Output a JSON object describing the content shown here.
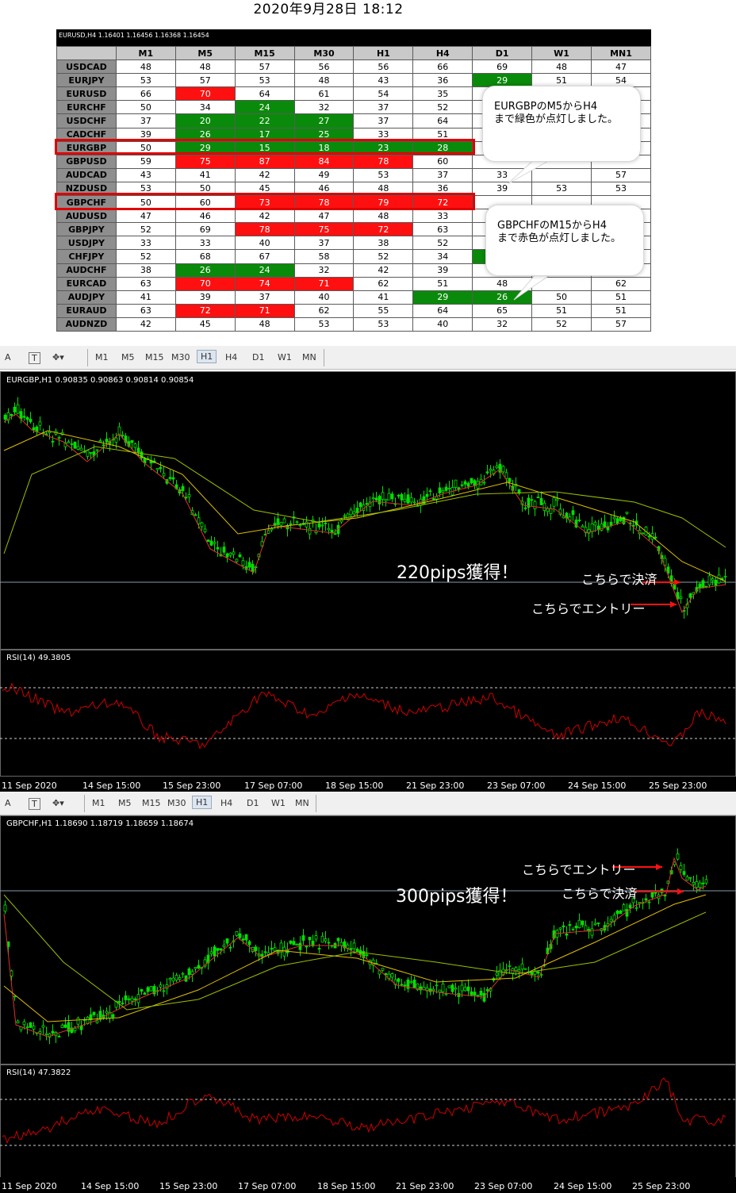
{
  "header": {
    "date": "2020年9月28日 18:12"
  },
  "table": {
    "title": "EURUSD,H4  1.16401 1.16456 1.16368 1.16454",
    "columns": [
      "M1",
      "M5",
      "M15",
      "M30",
      "H1",
      "H4",
      "D1",
      "W1",
      "MN1"
    ],
    "rows": [
      {
        "sym": "USDCAD",
        "vals": [
          "48",
          "48",
          "57",
          "56",
          "56",
          "66",
          "69",
          "48",
          "47"
        ],
        "c": [
          "",
          "",
          "",
          "",
          "",
          "",
          "",
          "",
          ""
        ]
      },
      {
        "sym": "EURJPY",
        "vals": [
          "53",
          "57",
          "53",
          "48",
          "43",
          "36",
          "29",
          "51",
          "54"
        ],
        "c": [
          "",
          "",
          "",
          "",
          "",
          "",
          "g",
          "",
          ""
        ]
      },
      {
        "sym": "EURUSD",
        "vals": [
          "66",
          "70",
          "64",
          "61",
          "54",
          "35",
          "",
          "",
          ""
        ],
        "c": [
          "",
          "r",
          "",
          "",
          "",
          "",
          "",
          "",
          ""
        ]
      },
      {
        "sym": "EURCHF",
        "vals": [
          "50",
          "34",
          "24",
          "32",
          "37",
          "52",
          "",
          "",
          ""
        ],
        "c": [
          "",
          "",
          "g",
          "",
          "",
          "",
          "",
          "",
          ""
        ]
      },
      {
        "sym": "USDCHF",
        "vals": [
          "37",
          "20",
          "22",
          "27",
          "37",
          "64",
          "",
          "",
          ""
        ],
        "c": [
          "",
          "g",
          "g",
          "g",
          "",
          "",
          "",
          "",
          ""
        ]
      },
      {
        "sym": "CADCHF",
        "vals": [
          "39",
          "26",
          "17",
          "25",
          "33",
          "51",
          "",
          "",
          ""
        ],
        "c": [
          "",
          "g",
          "g",
          "g",
          "",
          "",
          "",
          "",
          ""
        ]
      },
      {
        "sym": "EURGBP",
        "vals": [
          "50",
          "29",
          "15",
          "18",
          "23",
          "28",
          "",
          "",
          ""
        ],
        "c": [
          "",
          "g",
          "g",
          "g",
          "g",
          "g",
          "",
          "",
          ""
        ]
      },
      {
        "sym": "GBPUSD",
        "vals": [
          "59",
          "75",
          "87",
          "84",
          "78",
          "60",
          "",
          "",
          ""
        ],
        "c": [
          "",
          "r",
          "r",
          "r",
          "r",
          "",
          "",
          "",
          ""
        ]
      },
      {
        "sym": "AUDCAD",
        "vals": [
          "43",
          "41",
          "42",
          "49",
          "53",
          "37",
          "33",
          "",
          "57"
        ],
        "c": [
          "",
          "",
          "",
          "",
          "",
          "",
          "",
          "",
          ""
        ]
      },
      {
        "sym": "NZDUSD",
        "vals": [
          "53",
          "50",
          "45",
          "46",
          "48",
          "36",
          "39",
          "53",
          "53"
        ],
        "c": [
          "",
          "",
          "",
          "",
          "",
          "",
          "",
          "",
          ""
        ]
      },
      {
        "sym": "GBPCHF",
        "vals": [
          "50",
          "60",
          "73",
          "78",
          "79",
          "72",
          "",
          "",
          ""
        ],
        "c": [
          "",
          "",
          "r",
          "r",
          "r",
          "r",
          "",
          "",
          ""
        ]
      },
      {
        "sym": "AUDUSD",
        "vals": [
          "47",
          "46",
          "42",
          "47",
          "48",
          "33",
          "",
          "",
          ""
        ],
        "c": [
          "",
          "",
          "",
          "",
          "",
          "",
          "",
          "",
          ""
        ]
      },
      {
        "sym": "GBPJPY",
        "vals": [
          "52",
          "69",
          "78",
          "75",
          "72",
          "63",
          "",
          "",
          ""
        ],
        "c": [
          "",
          "",
          "r",
          "r",
          "r",
          "",
          "",
          "",
          ""
        ]
      },
      {
        "sym": "USDJPY",
        "vals": [
          "33",
          "33",
          "40",
          "37",
          "38",
          "52",
          "",
          "",
          ""
        ],
        "c": [
          "",
          "",
          "",
          "",
          "",
          "",
          "",
          "",
          ""
        ]
      },
      {
        "sym": "CHFJPY",
        "vals": [
          "52",
          "68",
          "67",
          "58",
          "52",
          "34",
          "",
          "",
          ""
        ],
        "c": [
          "",
          "",
          "",
          "",
          "",
          "",
          "g",
          "",
          ""
        ]
      },
      {
        "sym": "AUDCHF",
        "vals": [
          "38",
          "26",
          "24",
          "32",
          "42",
          "39",
          "",
          "",
          ""
        ],
        "c": [
          "",
          "g",
          "g",
          "",
          "",
          "",
          "",
          "",
          ""
        ]
      },
      {
        "sym": "EURCAD",
        "vals": [
          "63",
          "70",
          "74",
          "71",
          "62",
          "51",
          "48",
          "",
          "62"
        ],
        "c": [
          "",
          "r",
          "r",
          "r",
          "",
          "",
          "",
          "",
          ""
        ]
      },
      {
        "sym": "AUDJPY",
        "vals": [
          "41",
          "39",
          "37",
          "40",
          "41",
          "29",
          "26",
          "50",
          "51"
        ],
        "c": [
          "",
          "",
          "",
          "",
          "",
          "g",
          "g",
          "",
          ""
        ]
      },
      {
        "sym": "EURAUD",
        "vals": [
          "63",
          "72",
          "71",
          "62",
          "55",
          "64",
          "65",
          "51",
          "51"
        ],
        "c": [
          "",
          "r",
          "r",
          "",
          "",
          "",
          "",
          "",
          ""
        ]
      },
      {
        "sym": "AUDNZD",
        "vals": [
          "42",
          "45",
          "48",
          "53",
          "53",
          "40",
          "32",
          "52",
          "57"
        ],
        "c": [
          "",
          "",
          "",
          "",
          "",
          "",
          "",
          "",
          ""
        ]
      }
    ]
  },
  "bubbles": {
    "b1": "EURGBPのM5からH4\nまで緑色が点灯しました。",
    "b2": "GBPCHFのM15からH4\nまで赤色が点灯しました。"
  },
  "toolbar": {
    "a": "A",
    "t": "T",
    "tfs": [
      "M1",
      "M5",
      "M15",
      "M30",
      "H1",
      "H4",
      "D1",
      "W1",
      "MN"
    ]
  },
  "chart1": {
    "label": "EURGBP,H1  0.90835 0.90863 0.90814 0.90854",
    "pips": "220pips獲得！",
    "exit": "こちらで決済",
    "entry": "こちらでエントリー",
    "rsi": "RSI(14) 49.3805"
  },
  "chart2": {
    "label": "GBPCHF,H1  1.18690 1.18719 1.18659 1.18674",
    "pips": "300pips獲得！",
    "exit": "こちらで決済",
    "entry": "こちらでエントリー",
    "rsi": "RSI(14) 47.3822"
  },
  "xlabels": [
    "11 Sep 2020",
    "14 Sep 15:00",
    "15 Sep 23:00",
    "17 Sep 07:00",
    "18 Sep 15:00",
    "21 Sep 23:00",
    "23 Sep 07:00",
    "24 Sep 15:00",
    "25 Sep 23:00"
  ],
  "xlabels2": [
    "11 Sep 2020",
    "14 Sep 15:00",
    "15 Sep 23:00",
    "17 Sep 07:00",
    "18 Sep 15:00",
    "21 Sep 23:00",
    "23 Sep 07:00",
    "24 Sep 15:00",
    "25 Sep 23:00"
  ],
  "colors": {
    "bull": "#00e000",
    "ma_fast": "#e03030",
    "ma_mid": "#e0c000",
    "ma_slow": "#9ac000",
    "rsi": "#d00000"
  }
}
